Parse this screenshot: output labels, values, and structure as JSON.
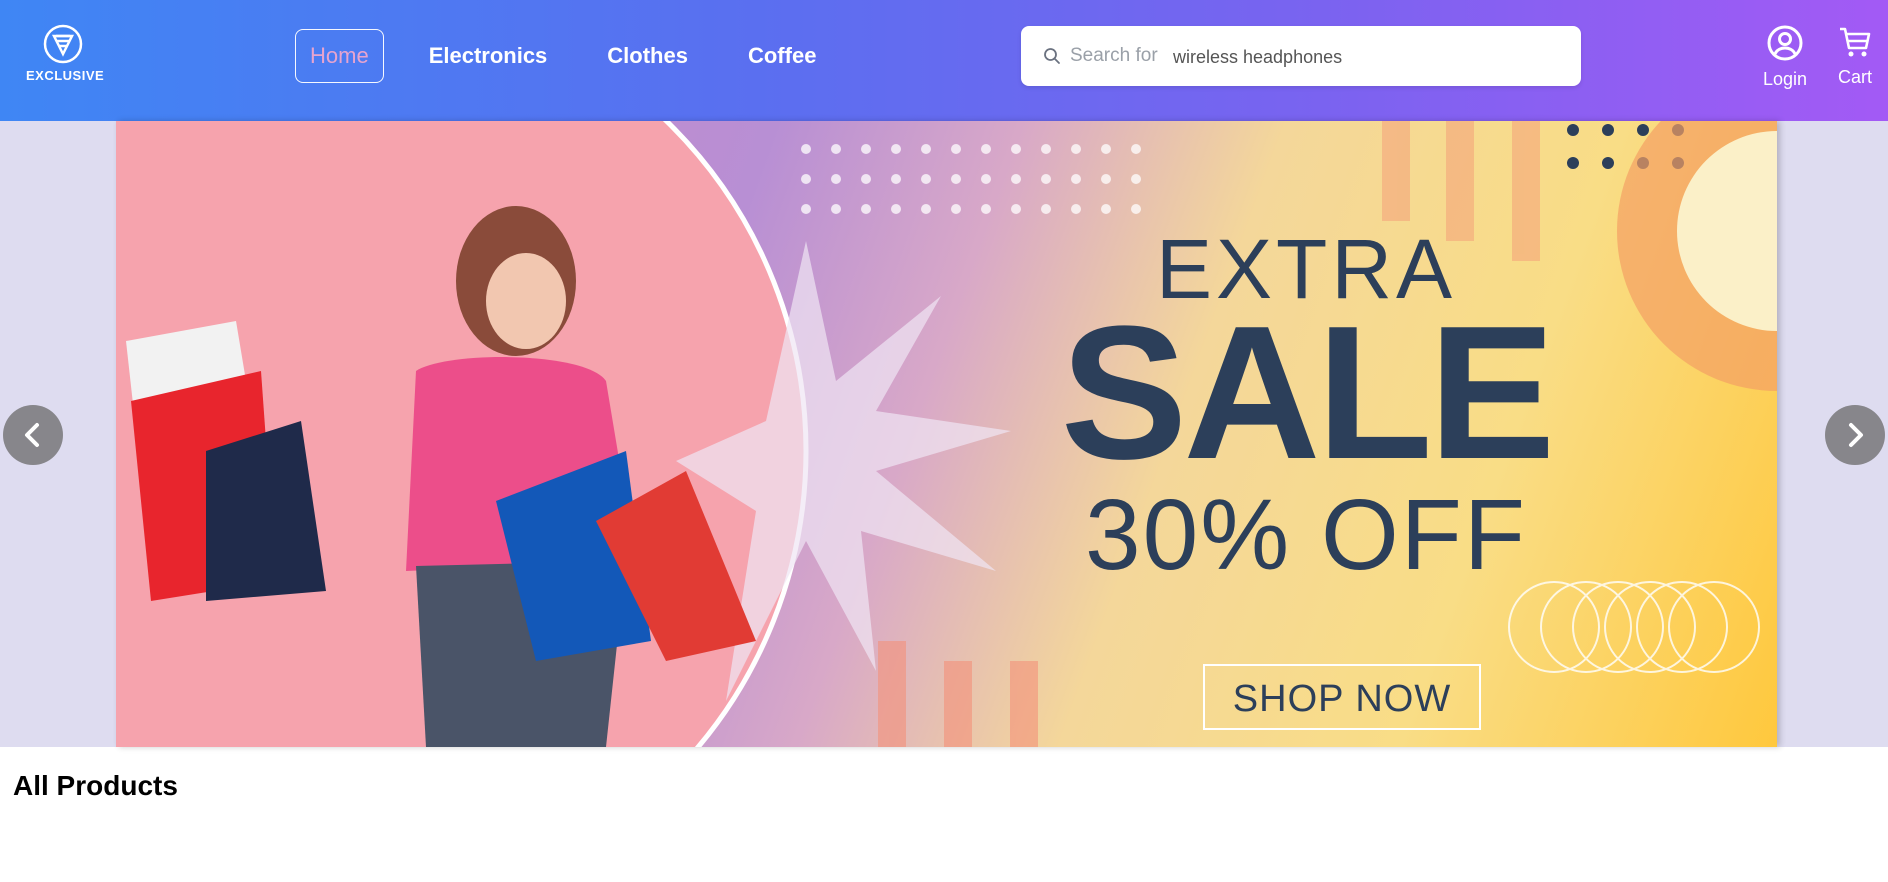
{
  "brand": {
    "name": "EXCLUSIVE",
    "logo_icon": "e-shield-logo-icon"
  },
  "nav": {
    "links": [
      {
        "label": "Home",
        "active": true
      },
      {
        "label": "Electronics",
        "active": false
      },
      {
        "label": "Clothes",
        "active": false
      },
      {
        "label": "Coffee",
        "active": false
      }
    ]
  },
  "search": {
    "label": "Search for",
    "value": "wireless headphones",
    "icon": "search-icon"
  },
  "actions": {
    "login": {
      "label": "Login",
      "icon": "user-circle-icon"
    },
    "cart": {
      "label": "Cart",
      "icon": "cart-icon"
    }
  },
  "banner": {
    "line1": "EXTRA",
    "line2": "SALE",
    "line3": "30% OFF",
    "cta": "SHOP NOW"
  },
  "carousel": {
    "prev_icon": "chevron-left-icon",
    "next_icon": "chevron-right-icon"
  },
  "section": {
    "title": "All Products"
  },
  "colors": {
    "nav_gradient_start": "#3f86f4",
    "nav_gradient_end": "#a35af5",
    "banner_text": "#2c3f5a",
    "hero_band": "#dedcf0"
  }
}
